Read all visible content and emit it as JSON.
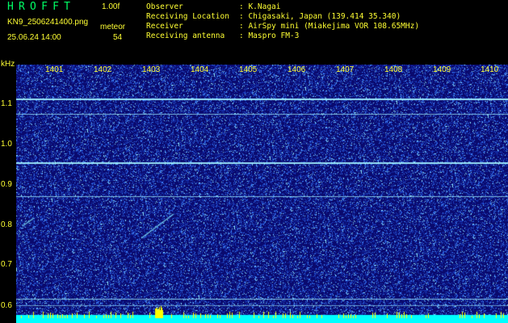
{
  "header": {
    "app_title": "HROFFT",
    "version": "1.00f",
    "filename": "KN9_2506241400.png",
    "meteor_label": "meteor",
    "datetime": "25.06.24 14:00",
    "meteor_count": "54",
    "info": [
      {
        "key": "Observer",
        "value": ": K.Nagai"
      },
      {
        "key": "Receiving Location",
        "value": ": Chigasaki, Japan (139.414 35.340)"
      },
      {
        "key": "Receiver",
        "value": ": AirSpy mini (Miakejima VOR 108.65MHz)"
      },
      {
        "key": "Receiving antenna",
        "value": ": Maspro FM-3"
      }
    ]
  },
  "plot": {
    "y_unit": "kHz",
    "time_labels": [
      "1401",
      "1402",
      "1403",
      "1404",
      "1405",
      "1406",
      "1407",
      "1408",
      "1409",
      "1410"
    ],
    "freq_labels": [
      "1.1",
      "1.0",
      "0.9",
      "0.8",
      "0.7",
      "0.6"
    ],
    "colors": {
      "background": "#0a0a6e",
      "noise_light": "#5aa0ff",
      "noise_cyan": "#7fe8ff",
      "carrier_line": "#a0f0ff",
      "bottom_band": "#00ffff",
      "bottom_spikes": "#ffff00",
      "text": "#ffff33",
      "title": "#00ff66"
    }
  }
}
